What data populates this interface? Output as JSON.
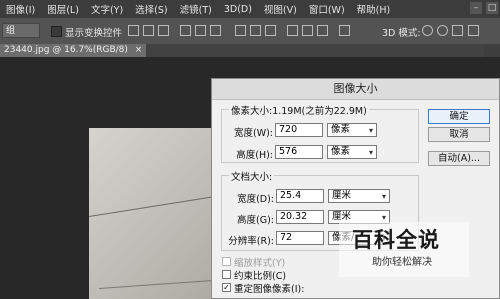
{
  "menu": {
    "items": [
      "图像(I)",
      "图层(L)",
      "文字(Y)",
      "选择(S)",
      "滤镜(T)",
      "3D(D)",
      "视图(V)",
      "窗口(W)",
      "帮助(H)"
    ]
  },
  "options": {
    "select_value": "组",
    "show_transform_label": "显示变换控件",
    "mode_3d_label": "3D 模式:"
  },
  "doc_tab": {
    "label": "23440.jpg @ 16.7%(RGB/8)",
    "close": "×"
  },
  "dialog": {
    "title": "图像大小",
    "pixel_size": {
      "title": "像素大小:1.19M(之前为22.9M)",
      "width_label": "宽度(W):",
      "width_value": "720",
      "width_unit": "像素",
      "height_label": "高度(H):",
      "height_value": "576",
      "height_unit": "像素"
    },
    "doc_size": {
      "title": "文档大小:",
      "width_label": "宽度(D):",
      "width_value": "25.4",
      "width_unit": "厘米",
      "height_label": "高度(G):",
      "height_value": "20.32",
      "height_unit": "厘米",
      "res_label": "分辨率(R):",
      "res_value": "72",
      "res_unit": "像素/"
    },
    "buttons": {
      "ok": "确定",
      "cancel": "取消",
      "auto": "自动(A)..."
    },
    "checkboxes": {
      "scale_styles": "缩放样式(Y)",
      "constrain": "约束比例(C)",
      "resample": "重定图像像素(I):"
    }
  },
  "watermark": {
    "main": "百科全说",
    "sub": "助你轻松解决"
  }
}
